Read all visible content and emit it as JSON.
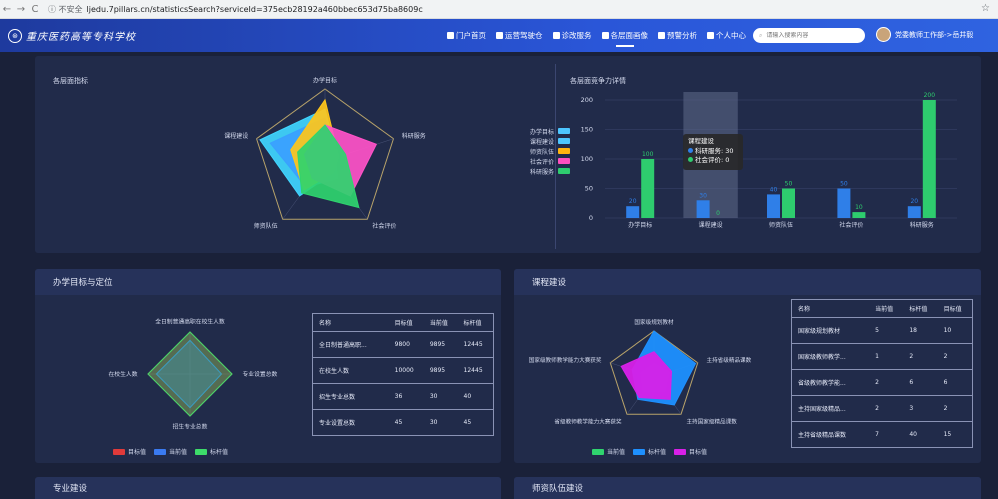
{
  "browser": {
    "back": "←",
    "forward": "→",
    "reload": "C",
    "security": "ⓘ 不安全",
    "url": "ljedu.7pillars.cn/statisticsSearch?serviceId=375ecb28192a460bbec653d75ba8609c"
  },
  "header": {
    "logo_text": "重庆医药高等专科学校",
    "nav": [
      "门户首页",
      "运营驾驶仓",
      "诊改服务",
      "各层面画像",
      "预警分析",
      "个人中心"
    ],
    "search_placeholder": "请输入搜索内容",
    "user": "党委教师工作部->岳井毅"
  },
  "top": {
    "radar_title": "各层面指标",
    "radar_axes": [
      "办学目标",
      "科研服务",
      "社会评价",
      "师资队伍",
      "课程建设"
    ],
    "legend": [
      {
        "name": "办学目标",
        "color": "#4dc6ff"
      },
      {
        "name": "课程建设",
        "color": "#4dc6ff"
      },
      {
        "name": "师资队伍",
        "color": "#ffb40f"
      },
      {
        "name": "社会评价",
        "color": "#ff4fbf"
      },
      {
        "name": "科研服务",
        "color": "#2ecc6e"
      }
    ],
    "bar_title": "各层面竞争力详情",
    "tooltip_title": "课程建设",
    "tooltip_lines": [
      "科研服务: 30",
      "社会评价: 0"
    ]
  },
  "chart_data": [
    {
      "type": "radar",
      "title": "各层面指标",
      "axes": [
        "办学目标",
        "科研服务",
        "社会评价",
        "师资队伍",
        "课程建设"
      ],
      "series": [
        {
          "name": "办学目标",
          "color": "#40d6ff",
          "values": [
            0.72,
            0.18,
            0.2,
            0.6,
            0.95
          ]
        },
        {
          "name": "课程建设",
          "color": "#3aa0ff",
          "values": [
            0.6,
            0.15,
            0.3,
            0.45,
            0.8
          ]
        },
        {
          "name": "师资队伍",
          "color": "#ffc61a",
          "values": [
            0.85,
            0.2,
            0.2,
            0.5,
            0.5
          ]
        },
        {
          "name": "社会评价",
          "color": "#ff52c8",
          "values": [
            0.5,
            0.75,
            0.6,
            0.3,
            0.3
          ]
        },
        {
          "name": "科研服务",
          "color": "#2fd46e",
          "values": [
            0.5,
            0.3,
            0.8,
            0.55,
            0.4
          ]
        }
      ]
    },
    {
      "type": "bar",
      "title": "各层面竞争力详情",
      "categories": [
        "办学目标",
        "课程建设",
        "师资队伍",
        "社会评价",
        "科研服务"
      ],
      "ylim": [
        0,
        200
      ],
      "yticks": [
        0,
        50,
        100,
        150,
        200
      ],
      "series": [
        {
          "name": "科研服务",
          "color": "#2f7fe8",
          "values": [
            20,
            30,
            40,
            50,
            20
          ]
        },
        {
          "name": "社会评价",
          "color": "#2ecc6e",
          "values": [
            100,
            0,
            50,
            10,
            200
          ]
        }
      ]
    },
    {
      "type": "radar",
      "title": "办学目标与定位",
      "axes": [
        "全日制普通高职在校生人数",
        "专业设置总数",
        "招生专业总数",
        "在校生人数"
      ],
      "series": [
        {
          "name": "目标值",
          "color": "#e03a3a",
          "values": [
            1,
            1,
            1,
            1
          ]
        },
        {
          "name": "当前值",
          "color": "#3a7af0",
          "values": [
            0.8,
            0.75,
            0.8,
            0.8
          ]
        },
        {
          "name": "标杆值",
          "color": "#3ddc6a",
          "values": [
            1,
            1,
            1,
            1
          ]
        }
      ]
    },
    {
      "type": "radar",
      "title": "课程建设",
      "axes": [
        "国家级规划教材",
        "主持省级精品课数",
        "主持国家级精品课数",
        "省级教师教学能力大赛获奖",
        "国家级教师教学能力大赛获奖"
      ],
      "series": [
        {
          "name": "当前值",
          "color": "#2fd46e",
          "values": [
            0.3,
            0.35,
            0.4,
            0.4,
            0.3
          ]
        },
        {
          "name": "标杆值",
          "color": "#1e90ff",
          "values": [
            1,
            0.95,
            0.75,
            0.6,
            0.5
          ]
        },
        {
          "name": "目标值",
          "color": "#d820e8",
          "values": [
            0.55,
            0.4,
            0.6,
            0.55,
            0.75
          ]
        }
      ]
    }
  ],
  "goal": {
    "title": "办学目标与定位",
    "axes": [
      "全日制普通高职在校生人数",
      "专业设置总数",
      "招生专业总数",
      "在校生人数"
    ],
    "legend": [
      {
        "name": "目标值",
        "color": "#e03a3a"
      },
      {
        "name": "当前值",
        "color": "#3a7af0"
      },
      {
        "name": "标杆值",
        "color": "#3ddc6a"
      }
    ],
    "headers": [
      "名称",
      "目标值",
      "当前值",
      "标杆值"
    ],
    "rows": [
      [
        "全日制普通高职...",
        "9800",
        "9895",
        "12445"
      ],
      [
        "在校生人数",
        "10000",
        "9895",
        "12445"
      ],
      [
        "招生专业总数",
        "36",
        "30",
        "40"
      ],
      [
        "专业设置总数",
        "45",
        "30",
        "45"
      ]
    ]
  },
  "course": {
    "title": "课程建设",
    "axes": [
      "国家级规划教材",
      "主持省级精品课数",
      "主持国家级精品课数",
      "省级教师教学能力大赛获奖",
      "国家级教师教学能力大赛获奖"
    ],
    "legend": [
      {
        "name": "当前值",
        "color": "#2fd46e"
      },
      {
        "name": "标杆值",
        "color": "#1e90ff"
      },
      {
        "name": "目标值",
        "color": "#d820e8"
      }
    ],
    "headers": [
      "名称",
      "当前值",
      "标杆值",
      "目标值"
    ],
    "rows": [
      [
        "国家级规划教材",
        "5",
        "18",
        "10"
      ],
      [
        "国家级教师教学...",
        "1",
        "2",
        "2"
      ],
      [
        "省级教师教学能...",
        "2",
        "6",
        "6"
      ],
      [
        "主持国家级精品...",
        "2",
        "3",
        "2"
      ],
      [
        "主持省级精品课数",
        "7",
        "40",
        "15"
      ]
    ]
  },
  "bottom": {
    "left_title": "专业建设",
    "right_title": "师资队伍建设"
  }
}
